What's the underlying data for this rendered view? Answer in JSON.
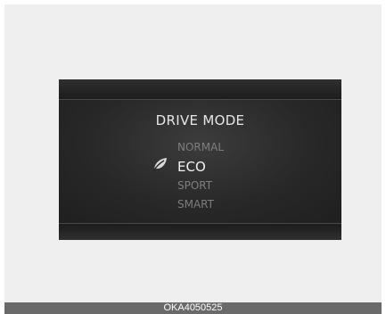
{
  "display": {
    "title": "DRIVE MODE",
    "modes": [
      {
        "label": "NORMAL",
        "selected": false
      },
      {
        "label": "ECO",
        "selected": true
      },
      {
        "label": "SPORT",
        "selected": false
      },
      {
        "label": "SMART",
        "selected": false
      }
    ],
    "selected_icon": "leaf-icon"
  },
  "caption": "OKA4050525",
  "colors": {
    "selected_text": "#f4f4f4",
    "unselected_text": "#7e7e7e",
    "caption_bar": "#6a6a6a"
  }
}
